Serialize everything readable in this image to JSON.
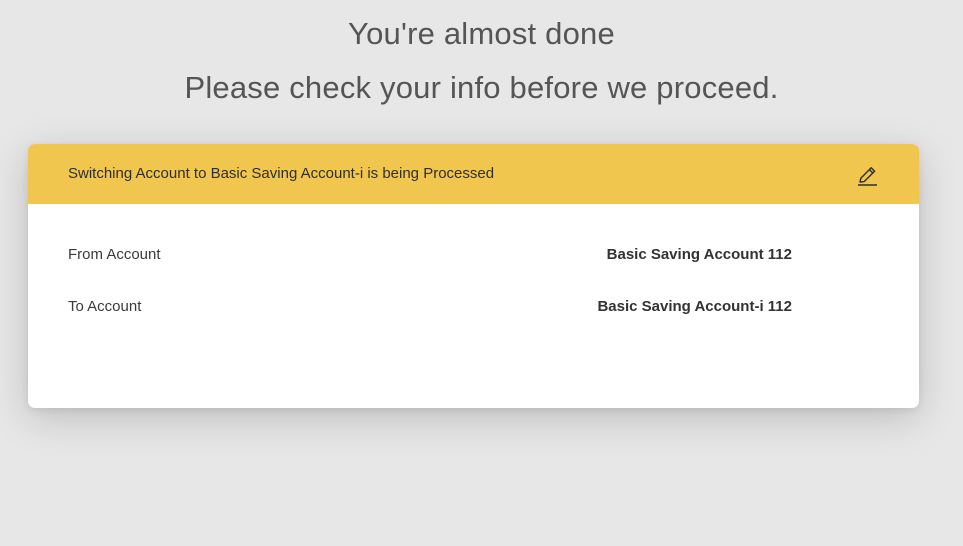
{
  "page": {
    "title": "You're almost done",
    "subtitle": "Please check your info before we proceed."
  },
  "card": {
    "header_text": "Switching Account to Basic Saving Account-i is being Processed",
    "edit_icon": "pencil-icon",
    "header_color": "#f0c64f",
    "rows": [
      {
        "label": "From Account",
        "value": "Basic Saving Account 112"
      },
      {
        "label": "To Account",
        "value": "Basic Saving Account-i 112"
      }
    ]
  }
}
